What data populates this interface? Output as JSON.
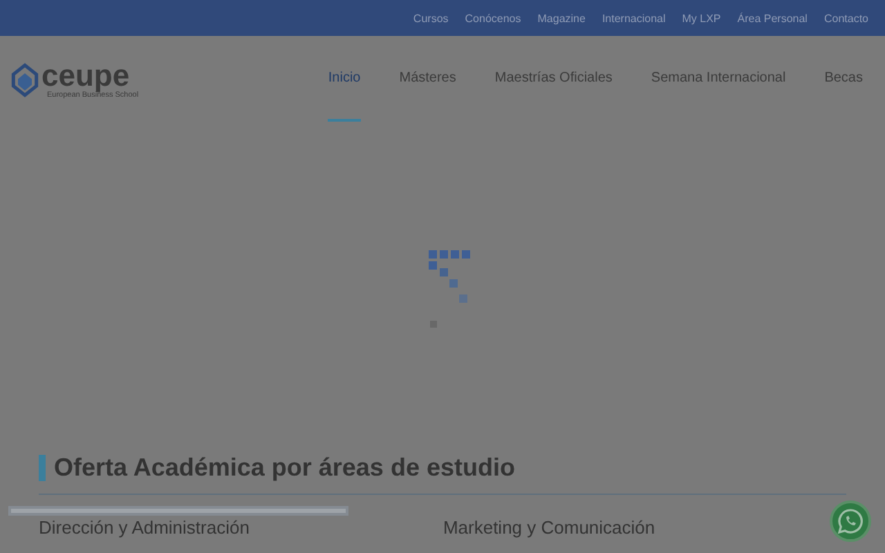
{
  "top_bar": {
    "links": [
      "Cursos",
      "Conócenos",
      "Magazine",
      "Internacional",
      "My LXP",
      "Área Personal",
      "Contacto"
    ]
  },
  "logo": {
    "name": "ceupe",
    "tagline": "European Business School"
  },
  "nav": [
    {
      "label": "Inicio",
      "selected": true
    },
    {
      "label": "Másteres",
      "selected": false
    },
    {
      "label": "Maestrías Oficiales",
      "selected": false
    },
    {
      "label": "Semana Internacional",
      "selected": false
    },
    {
      "label": "Becas",
      "selected": false
    }
  ],
  "section": {
    "title": "Oferta Académica por áreas de estudio",
    "areas": [
      "Dirección y Administración",
      "Marketing y Comunicación"
    ]
  }
}
